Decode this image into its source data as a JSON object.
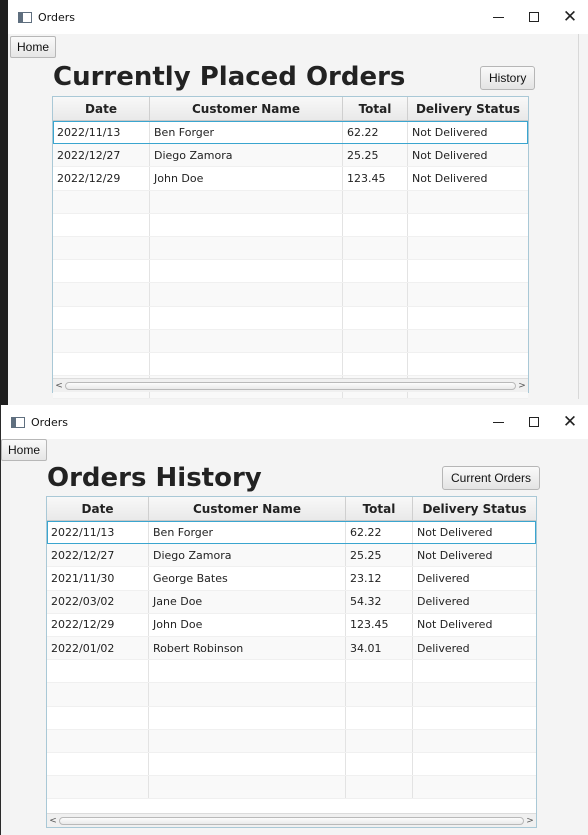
{
  "windows": [
    {
      "title": "Orders",
      "home_label": "Home",
      "heading": "Currently Placed Orders",
      "action_label": "History",
      "columns": [
        "Date",
        "Customer Name",
        "Total",
        "Delivery Status"
      ],
      "rows": [
        [
          "2022/11/13",
          "Ben Forger",
          "62.22",
          "Not Delivered"
        ],
        [
          "2022/12/27",
          "Diego Zamora",
          "25.25",
          "Not Delivered"
        ],
        [
          "2022/12/29",
          "John Doe",
          "123.45",
          "Not Delivered"
        ]
      ],
      "empty_rows": 9,
      "selected_row": 0
    },
    {
      "title": "Orders",
      "home_label": "Home",
      "heading": "Orders History",
      "action_label": "Current Orders",
      "columns": [
        "Date",
        "Customer Name",
        "Total",
        "Delivery Status"
      ],
      "rows": [
        [
          "2022/11/13",
          "Ben Forger",
          "62.22",
          "Not Delivered"
        ],
        [
          "2022/12/27",
          "Diego Zamora",
          "25.25",
          "Not Delivered"
        ],
        [
          "2021/11/30",
          "George Bates",
          "23.12",
          "Delivered"
        ],
        [
          "2022/03/02",
          "Jane Doe",
          "54.32",
          "Delivered"
        ],
        [
          "2022/12/29",
          "John Doe",
          "123.45",
          "Not Delivered"
        ],
        [
          "2022/01/02",
          "Robert Robinson",
          "34.01",
          "Delivered"
        ]
      ],
      "empty_rows": 6,
      "selected_row": 0
    }
  ],
  "colors": {
    "selection": "#3aa5cf",
    "table_border": "#a9c8d6",
    "window_bg": "#f4f4f4"
  },
  "icons": {
    "minimize": "minimize-icon",
    "maximize": "maximize-icon",
    "close": "close-icon",
    "app": "app-window-icon"
  }
}
